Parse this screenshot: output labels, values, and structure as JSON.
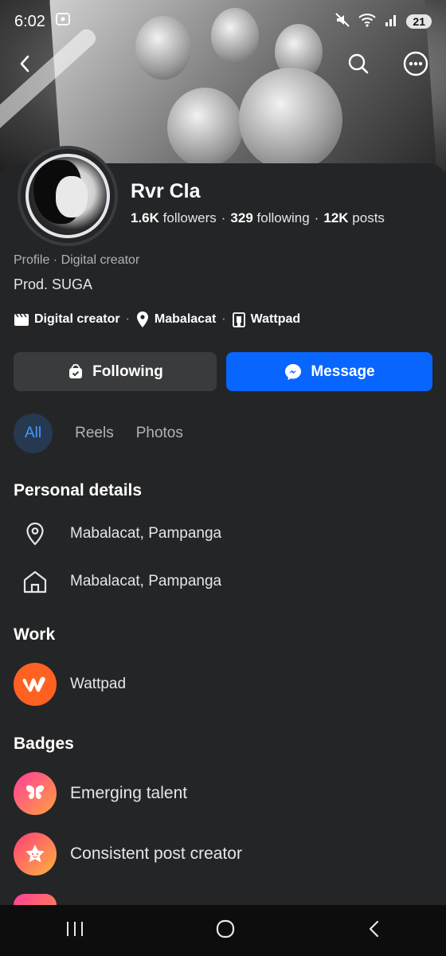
{
  "status": {
    "time": "6:02",
    "battery": "21"
  },
  "profile": {
    "name": "Rvr Cla",
    "followers_count": "1.6K",
    "followers_label": "followers",
    "following_count": "329",
    "following_label": "following",
    "posts_count": "12K",
    "posts_label": "posts",
    "type_line": "Profile · Digital creator",
    "bio": "Prod. SUGA",
    "meta": {
      "category": "Digital creator",
      "location": "Mabalacat",
      "work": "Wattpad"
    }
  },
  "actions": {
    "following_label": "Following",
    "message_label": "Message"
  },
  "tabs": [
    {
      "label": "All",
      "active": true
    },
    {
      "label": "Reels",
      "active": false
    },
    {
      "label": "Photos",
      "active": false
    }
  ],
  "personal_details": {
    "title": "Personal details",
    "lives_in": "Mabalacat, Pampanga",
    "from": "Mabalacat, Pampanga"
  },
  "work": {
    "title": "Work",
    "employer": "Wattpad"
  },
  "badges": {
    "title": "Badges",
    "items": [
      {
        "label": "Emerging talent"
      },
      {
        "label": "Consistent post creator"
      }
    ]
  },
  "colors": {
    "accent": "#0866ff",
    "background": "#242526",
    "wattpad": "#ff6122"
  }
}
